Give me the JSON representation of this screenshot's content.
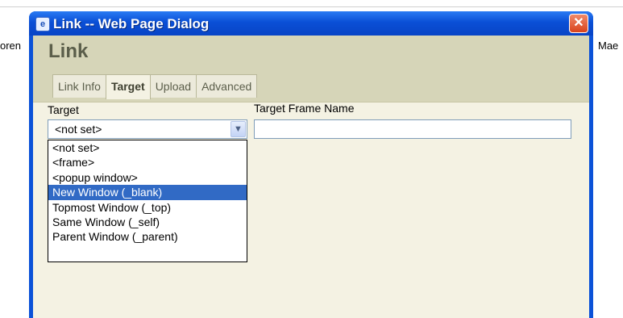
{
  "background": {
    "left_fragment": "oren",
    "right_fragment": "Mae"
  },
  "dialog": {
    "window_title": "Link -- Web Page Dialog",
    "close_glyph": "✕",
    "title_icon": "ie-page-icon",
    "heading": "Link",
    "tabs": [
      {
        "label": "Link Info",
        "active": false
      },
      {
        "label": "Target",
        "active": true
      },
      {
        "label": "Upload",
        "active": false
      },
      {
        "label": "Advanced",
        "active": false
      }
    ],
    "target": {
      "label": "Target",
      "selected_value": "<not set>",
      "dropdown_arrow": "chevron-down-icon",
      "options": [
        "<not set>",
        "<frame>",
        "<popup window>",
        "New Window (_blank)",
        "Topmost Window (_top)",
        "Same Window (_self)",
        "Parent Window (_parent)"
      ],
      "highlighted_option": "New Window (_blank)"
    },
    "target_frame_name": {
      "label": "Target Frame Name",
      "value": ""
    }
  },
  "colors": {
    "titlebar": "#0a4fd6",
    "dialog_bg": "#d6d5b8",
    "panel_bg": "#f4f2e3",
    "selection": "#316ac5",
    "close_button": "#d9431c"
  }
}
